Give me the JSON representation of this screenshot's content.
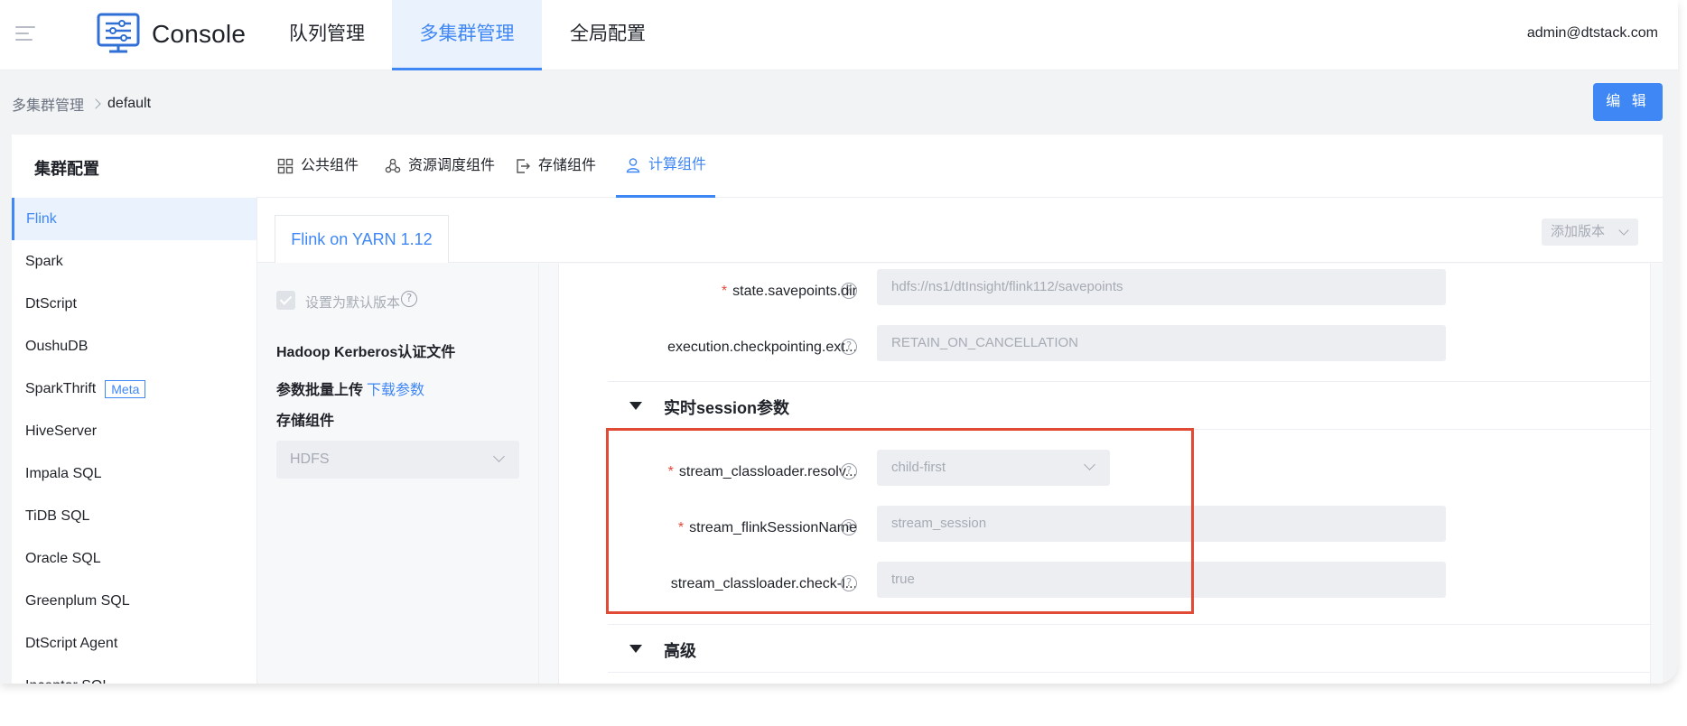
{
  "header": {
    "app_title": "Console",
    "nav": [
      {
        "label": "队列管理",
        "active": false
      },
      {
        "label": "多集群管理",
        "active": true
      },
      {
        "label": "全局配置",
        "active": false
      }
    ],
    "user": "admin@dtstack.com"
  },
  "breadcrumb": {
    "parent": "多集群管理",
    "current": "default"
  },
  "edit_button": "编 辑",
  "card": {
    "title": "集群配置",
    "component_tabs": [
      {
        "label": "公共组件",
        "icon": "grid-icon"
      },
      {
        "label": "资源调度组件",
        "icon": "cluster-icon"
      },
      {
        "label": "存储组件",
        "icon": "export-icon"
      },
      {
        "label": "计算组件",
        "icon": "user-icon",
        "active": true
      }
    ],
    "engines": [
      {
        "label": "Flink",
        "active": true
      },
      {
        "label": "Spark"
      },
      {
        "label": "DtScript"
      },
      {
        "label": "OushuDB"
      },
      {
        "label": "SparkThrift",
        "tag": "Meta"
      },
      {
        "label": "HiveServer"
      },
      {
        "label": "Impala SQL"
      },
      {
        "label": "TiDB SQL"
      },
      {
        "label": "Oracle SQL"
      },
      {
        "label": "Greenplum SQL"
      },
      {
        "label": "DtScript Agent"
      },
      {
        "label": "Inceptor SQL"
      }
    ]
  },
  "version_tab": "Flink on YARN 1.12",
  "add_version": "添加版本",
  "left_panel": {
    "default_version_label": "设置为默认版本",
    "default_version_checked": true,
    "kerberos_label": "Hadoop Kerberos认证文件",
    "batch_upload_label": "参数批量上传",
    "download_params_link": "下载参数",
    "storage_label": "存储组件",
    "storage_value": "HDFS"
  },
  "form": {
    "fields_top": [
      {
        "label": "state.savepoints.dir",
        "required": true,
        "value": "hdfs://ns1/dtInsight/flink112/savepoints"
      },
      {
        "label": "execution.checkpointing.ext...",
        "required": false,
        "value": "RETAIN_ON_CANCELLATION"
      }
    ],
    "section_session": "实时session参数",
    "fields_session": [
      {
        "label": "stream_classloader.resolv...",
        "required": true,
        "value": "child-first",
        "type": "select"
      },
      {
        "label": "stream_flinkSessionName",
        "required": true,
        "value": "stream_session"
      },
      {
        "label": "stream_classloader.check-l...",
        "required": false,
        "value": "true"
      }
    ],
    "section_advanced": "高级"
  },
  "colors": {
    "accent": "#3f87f5",
    "highlight": "#e14b35",
    "required": "#e5483a"
  }
}
